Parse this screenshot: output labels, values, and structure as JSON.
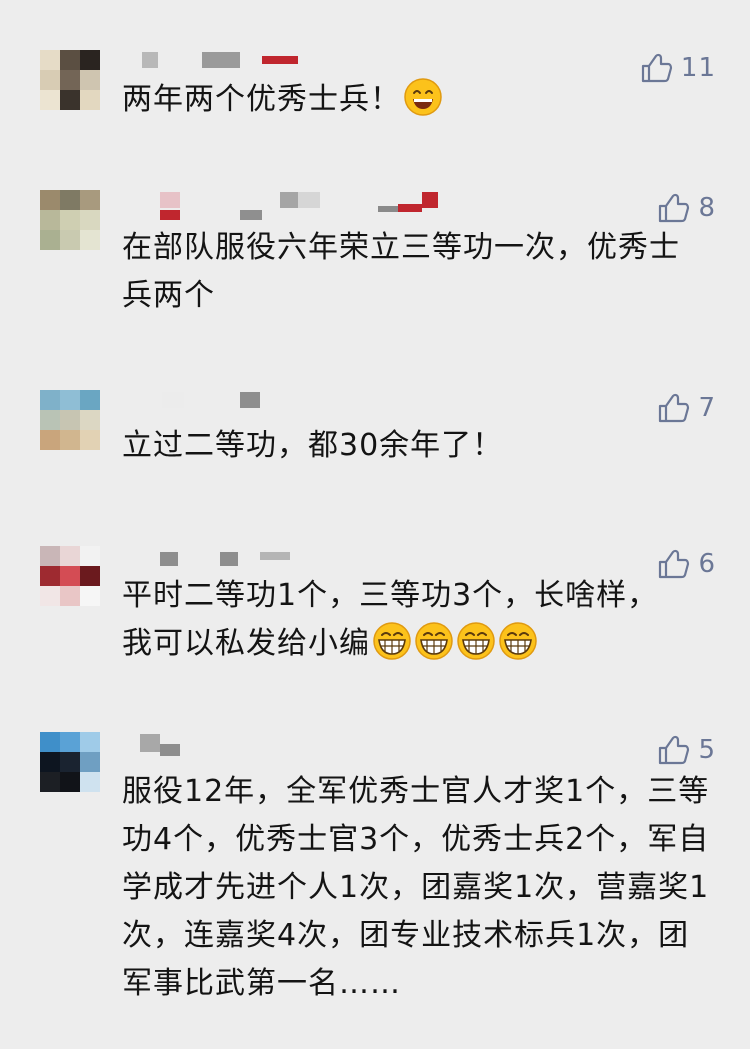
{
  "comments": [
    {
      "likes": "11",
      "text": "两年两个优秀士兵！",
      "emoji": "grinning-face-icon",
      "emoji_count": 1,
      "avatar_colors": [
        "#e6dcc7",
        "#5b4f42",
        "#2a2420",
        "#d8ccb4",
        "#736556",
        "#cfc5b0",
        "#ece4d2",
        "#3a332c",
        "#e3d8c0"
      ]
    },
    {
      "likes": "8",
      "text": "在部队服役六年荣立三等功一次，优秀士兵两个",
      "emoji": "",
      "emoji_count": 0,
      "avatar_colors": [
        "#9b8a6c",
        "#7f7a64",
        "#a89a7e",
        "#b8b89a",
        "#cfcfb2",
        "#d9d8c0",
        "#aab091",
        "#c9cab0",
        "#e4e4d2"
      ]
    },
    {
      "likes": "7",
      "text": "立过二等功，都30余年了！",
      "emoji": "",
      "emoji_count": 0,
      "avatar_colors": [
        "#7fb1c9",
        "#8fbed5",
        "#6aa6c2",
        "#b9c3b5",
        "#c7c5b2",
        "#dcd7c3",
        "#c9a57c",
        "#d1b68f",
        "#e2d2b4"
      ]
    },
    {
      "likes": "6",
      "text": "平时二等功1个，三等功3个，长啥样，我可以私发给小编",
      "emoji": "big-grin-face-icon",
      "emoji_count": 4,
      "avatar_colors": [
        "#c9b6b7",
        "#e9d6d6",
        "#f2f2f2",
        "#9e2a30",
        "#d44c54",
        "#6b1a1e",
        "#f1e6e6",
        "#e9c6c6",
        "#f6f6f6"
      ]
    },
    {
      "likes": "5",
      "text": "服役12年，全军优秀士官人才奖1个，三等功4个，优秀士官3个，优秀士兵2个，军自学成才先进个人1次，团嘉奖1次，营嘉奖1次，连嘉奖4次，团专业技术标兵1次，团军事比武第一名……",
      "emoji": "",
      "emoji_count": 0,
      "avatar_colors": [
        "#3f8fc9",
        "#5aa2d6",
        "#9fcbe8",
        "#0d1520",
        "#1a2330",
        "#6f9fc2",
        "#1c1f24",
        "#111318",
        "#cfe2ef"
      ]
    }
  ],
  "icons": {
    "like": "thumbs-up-icon"
  },
  "colors": {
    "like": "#6b7796",
    "background": "#ededed",
    "text": "#141414"
  }
}
